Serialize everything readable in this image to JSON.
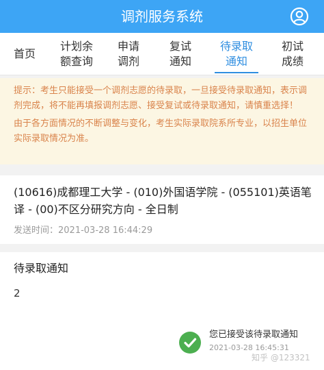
{
  "header": {
    "title": "调剂服务系统",
    "user_icon": "user-circle-icon",
    "background": "#3da5f5"
  },
  "tabs": [
    {
      "line1": "首页",
      "line2": "",
      "active": false
    },
    {
      "line1": "计划余",
      "line2": "额查询",
      "active": false
    },
    {
      "line1": "申请",
      "line2": "调剂",
      "active": false
    },
    {
      "line1": "复试",
      "line2": "通知",
      "active": false
    },
    {
      "line1": "待录取",
      "line2": "通知",
      "active": true
    },
    {
      "line1": "初试",
      "line2": "成绩",
      "active": false
    }
  ],
  "notice": {
    "paragraph1": "提示：考生只能接受一个调剂志愿的待录取，一旦接受待录取通知，表示调剂完成，将不能再填报调剂志愿、接受复试或待录取通知，请慎重选择！",
    "paragraph2": "由于各方面情况的不断调整与变化，考生实际录取院系所专业，以招生单位实际录取情况为准。",
    "text_color": "#d9834b",
    "background": "#fcf6e3"
  },
  "message": {
    "subject": "(10616)成都理工大学 - (010)外国语学院 - (055101)英语笔译 - (00)不区分研究方向 - 全日制",
    "sent_label": "发送时间：",
    "sent_time": "2021-03-28 16:44:29"
  },
  "detail": {
    "title": "待录取通知",
    "value": "2"
  },
  "status": {
    "icon": "check-circle-icon",
    "text": "您已接受该待录取通知",
    "time": "2021-03-28 16:45:31",
    "color": "#4caf50"
  },
  "watermark": "知乎 @123321",
  "accent_color": "#2f8ee0"
}
